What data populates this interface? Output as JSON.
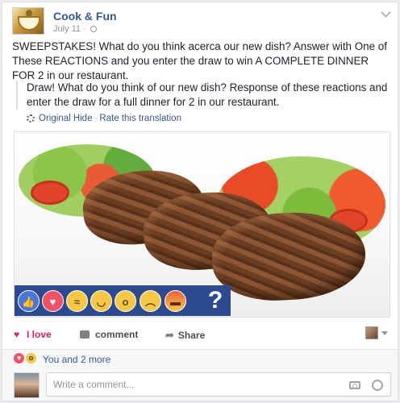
{
  "post": {
    "page_name": "Cook & Fun",
    "date": "July 11 ·",
    "text": "SWEEPSTAKES! What do you think acerca our new dish? Answer with One of These REACTIONS and you enter the draw to win A COMPLETE DINNER FOR 2 in our restaurant.",
    "translation": "Draw! What do you think of our new dish? Response of these reactions and enter the draw for a full dinner for 2 in our restaurant.",
    "translation_links": {
      "original_hide": "Original Hide",
      "rate": "Rate this translation",
      "separator": "·"
    }
  },
  "photo": {
    "overlay_reactions": [
      "like-icon",
      "love-icon",
      "haha-icon",
      "yay-icon",
      "wow-icon",
      "sad-icon",
      "angry-icon"
    ],
    "question_mark": "?"
  },
  "actions": {
    "love_label": "I love",
    "comment_label": "comment",
    "share_label": "Share"
  },
  "summary": {
    "text": "You and 2 more"
  },
  "composer": {
    "placeholder": "Write a comment..."
  },
  "colors": {
    "link": "#365899",
    "love": "#e0245e",
    "strip": "#2b4a8f"
  }
}
